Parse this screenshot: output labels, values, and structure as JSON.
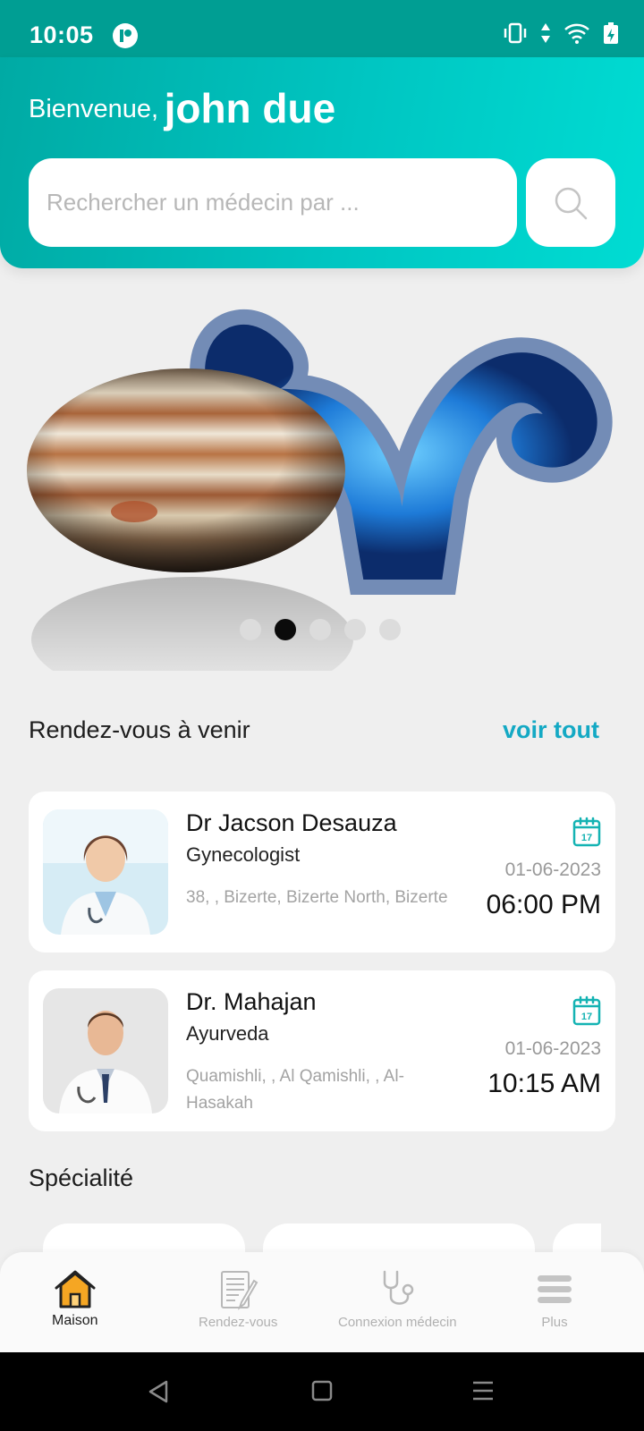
{
  "status_bar": {
    "time": "10:05"
  },
  "header": {
    "greeting_label": "Bienvenue,",
    "user_name": "john due",
    "search_placeholder": "Rechercher un médecin par ..."
  },
  "banner": {
    "slide_count": 5,
    "active_slide": 2
  },
  "appointments": {
    "title": "Rendez-vous à venir",
    "see_all": "voir tout",
    "items": [
      {
        "doctor": "Dr Jacson Desauza",
        "specialty": "Gynecologist",
        "address": "38, , Bizerte, Bizerte North, Bizerte",
        "date": "01-06-2023",
        "time": "06:00 PM"
      },
      {
        "doctor": "Dr. Mahajan",
        "specialty": "Ayurveda",
        "address": "Quamishli, , Al Qamishli, , Al-Hasakah",
        "date": "01-06-2023",
        "time": "10:15 AM"
      }
    ]
  },
  "specialty": {
    "title": "Spécialité"
  },
  "bottom_nav": {
    "items": [
      {
        "label": "Maison",
        "icon": "home-icon",
        "active": true
      },
      {
        "label": "Rendez-vous",
        "icon": "appointment-notes-icon",
        "active": false
      },
      {
        "label": "Connexion médecin",
        "icon": "stethoscope-icon",
        "active": false
      },
      {
        "label": "Plus",
        "icon": "menu-icon",
        "active": false
      }
    ]
  },
  "colors": {
    "header_gradient_start": "#00aaa4",
    "header_gradient_end": "#00dcd3",
    "accent": "#14a9c4",
    "home_icon": "#f5a623"
  }
}
